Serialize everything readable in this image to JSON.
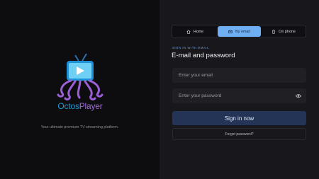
{
  "brand": {
    "name_part1": "Octos",
    "name_part2": "Player",
    "tagline": "Your ultimate premium TV streaming platform."
  },
  "tabs": [
    {
      "label": "Home",
      "icon": "home-icon",
      "active": false
    },
    {
      "label": "By email",
      "icon": "email-icon",
      "active": true
    },
    {
      "label": "On phone",
      "icon": "phone-icon",
      "active": false
    }
  ],
  "form": {
    "eyebrow": "SIGN IN WITH EMAIL",
    "title": "E-mail and password",
    "email_placeholder": "Enter your email",
    "password_placeholder": "Enter your password",
    "submit_label": "Sign in now",
    "forgot_label": "Forgot password?"
  },
  "colors": {
    "accent_tab": "#6fb0f4",
    "submit_bg": "#233456",
    "brand_blue": "#1e9ad8",
    "brand_purple": "#a06adb"
  }
}
